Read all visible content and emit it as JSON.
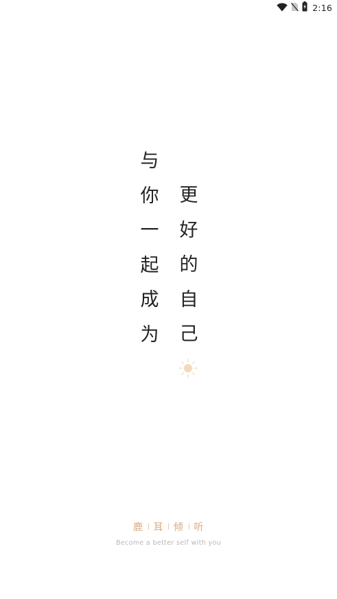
{
  "status_bar": {
    "time": "2:16",
    "icons": [
      "wifi-icon",
      "no-sim-icon",
      "battery-icon"
    ]
  },
  "slogan": {
    "left_column": [
      "与",
      "你",
      "一",
      "起",
      "成",
      "为"
    ],
    "right_column": [
      "更",
      "好",
      "的",
      "自",
      "己"
    ]
  },
  "decoration": {
    "icon": "sun-icon",
    "color": "#f2d9b9"
  },
  "brand": {
    "chars": [
      "鹿",
      "耳",
      "倾",
      "听"
    ],
    "color": "#d9a77c",
    "tagline": "Become a better self with you"
  }
}
